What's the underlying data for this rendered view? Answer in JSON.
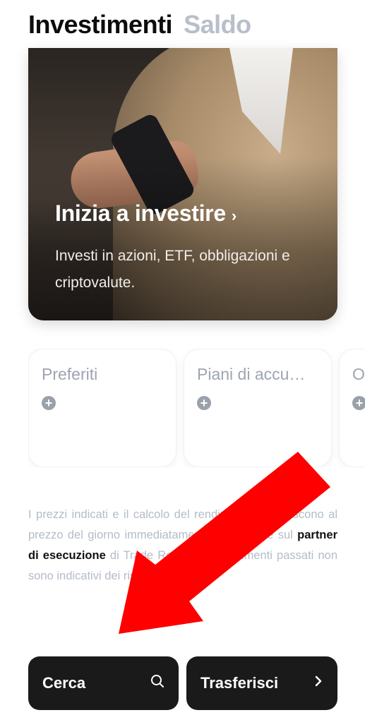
{
  "header": {
    "active_tab": "Investimenti",
    "inactive_tab": "Saldo"
  },
  "hero": {
    "title": "Inizia a investire",
    "chevron": "›",
    "subtitle": "Investi in azioni, ETF, obbligazioni e criptovalute."
  },
  "cards": [
    {
      "title": "Preferiti",
      "icon": "plus-icon"
    },
    {
      "title": "Piani di accu…",
      "icon": "plus-icon"
    },
    {
      "title": "O",
      "icon": "plus-icon"
    }
  ],
  "disclaimer": {
    "text_before": "I prezzi indicati e il calcolo del rendimento si riferiscono al prezzo del giorno immediatamente precedente sul ",
    "bold_text": "partner di esecuzione",
    "text_after": " di Trade Republic. I rendimenti passati non sono indicativi dei risultati futuri."
  },
  "buttons": {
    "search_label": "Cerca",
    "search_icon": "search-icon",
    "transfer_label": "Trasferisci",
    "transfer_icon": "chevron-right-icon"
  },
  "colors": {
    "annotation_arrow": "#ff0000",
    "button_bg": "#1a1a1a",
    "muted_text": "#b4bcc7"
  }
}
